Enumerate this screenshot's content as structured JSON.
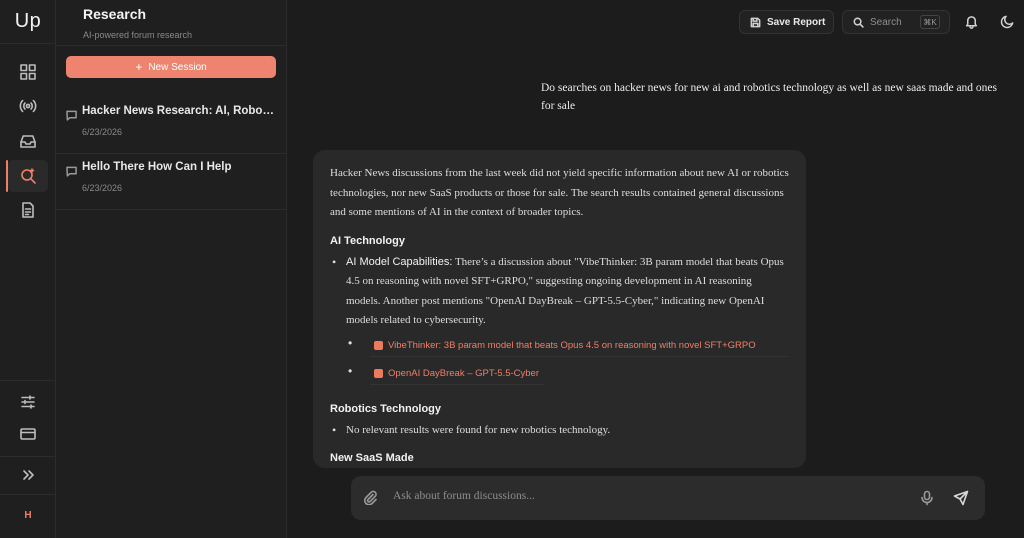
{
  "app": {
    "logo": "Up",
    "user_initial": "H"
  },
  "panel": {
    "title": "Research",
    "subtitle": "AI-powered forum research",
    "new_session_label": "New Session",
    "sessions": [
      {
        "title": "Hacker News Research: AI, Roboti...",
        "date": "6/23/2026"
      },
      {
        "title": "Hello There How Can I Help",
        "date": "6/23/2026"
      }
    ]
  },
  "header": {
    "save_label": "Save Report",
    "search_label": "Search",
    "search_shortcut": "⌘K"
  },
  "conversation": {
    "user_message": "Do searches on hacker news for new ai and robotics technology as well as new saas made and ones for sale",
    "reply": {
      "intro": "Hacker News discussions from the last week did not yield specific information about new AI or robotics technologies, nor new SaaS products or those for sale. The search results contained general discussions and some mentions of AI in the context of broader topics.",
      "sections": [
        {
          "heading": "AI Technology",
          "bullet_lead": "AI Model Capabilities:",
          "bullet_text": " There’s a discussion about \"VibeThinker: 3B param model that beats Opus 4.5 on reasoning with novel SFT+GRPO,\" suggesting ongoing development in AI reasoning models. Another post mentions \"OpenAI DayBreak – GPT-5.5-Cyber,\" indicating new OpenAI models related to cybersecurity.",
          "sources": [
            "VibeThinker: 3B param model that beats Opus 4.5 on reasoning with novel SFT+GRPO",
            "OpenAI DayBreak – GPT-5.5-Cyber"
          ]
        },
        {
          "heading": "Robotics Technology",
          "bullet_text": "No relevant results were found for new robotics technology."
        },
        {
          "heading": "New SaaS Made"
        }
      ]
    }
  },
  "composer": {
    "placeholder": "Ask about forum discussions..."
  },
  "colors": {
    "accent": "#ee8470",
    "background": "#1c1c1c",
    "bubble": "#292929"
  }
}
